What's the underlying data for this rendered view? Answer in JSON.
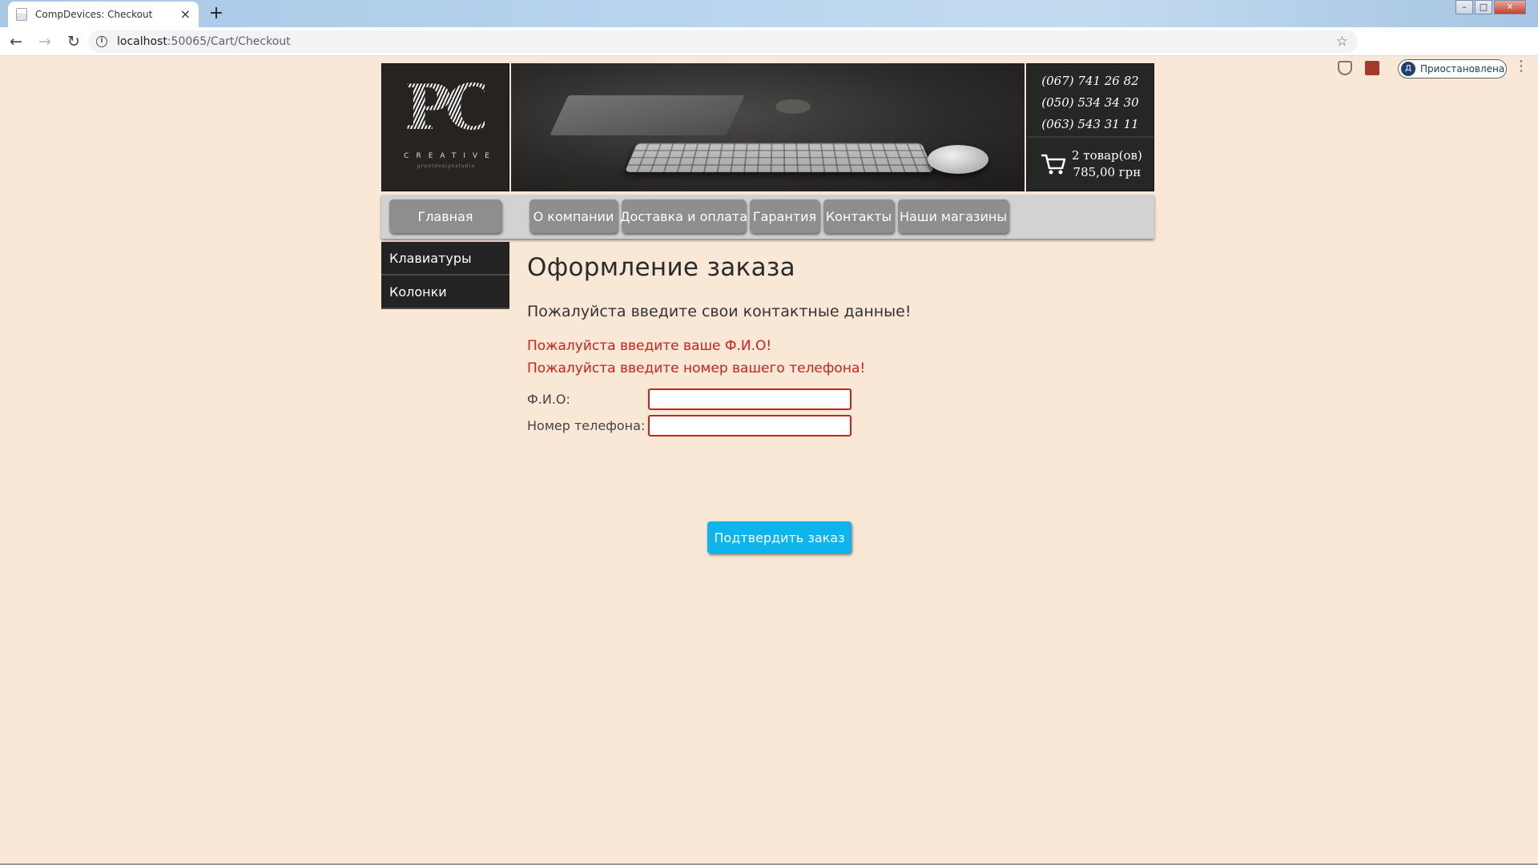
{
  "browser": {
    "tab_title": "CompDevices: Checkout",
    "tab_close": "×",
    "new_tab": "+",
    "url_host": "localhost",
    "url_path": ":50065/Cart/Checkout",
    "profile_initial": "Д",
    "profile_status": "Приостановлена",
    "icons": [
      "back-icon",
      "forward-icon",
      "reload-icon",
      "info-icon",
      "star-icon",
      "shield-icon",
      "pdf-icon",
      "menu-icon"
    ]
  },
  "site": {
    "logo": {
      "letters": "PC",
      "word": "CREATIVE",
      "tagline": "grantdesignstudio"
    },
    "phones": [
      "(067) 741 26 82",
      "(050) 534 34 30",
      "(063) 543 31 11"
    ],
    "cart": {
      "items": "2 товар(ов)",
      "total": "785,00 грн"
    },
    "nav": {
      "home": "Главная",
      "about": "О компании",
      "delivery": "Доставка и оплата",
      "warranty": "Гарантия",
      "contacts": "Контакты",
      "stores": "Наши магазины"
    },
    "categories": [
      "Клавиатуры",
      "Колонки"
    ]
  },
  "checkout": {
    "title": "Оформление заказа",
    "lead": "Пожалуйста введите свои контактные данные!",
    "errors": [
      "Пожалуйста введите ваше Ф.И.О!",
      "Пожалуйста введите номер вашего телефона!"
    ],
    "name_label": "Ф.И.О:",
    "name_value": "",
    "phone_label": "Номер телефона:",
    "phone_value": "",
    "submit_label": "Подтвердить заказ"
  },
  "colors": {
    "page_bg": "#f9e8d5",
    "error": "#d0211b",
    "submit": "#0fb4ec",
    "nav_button": "#8e8e8e",
    "dark_panel": "#262626"
  }
}
